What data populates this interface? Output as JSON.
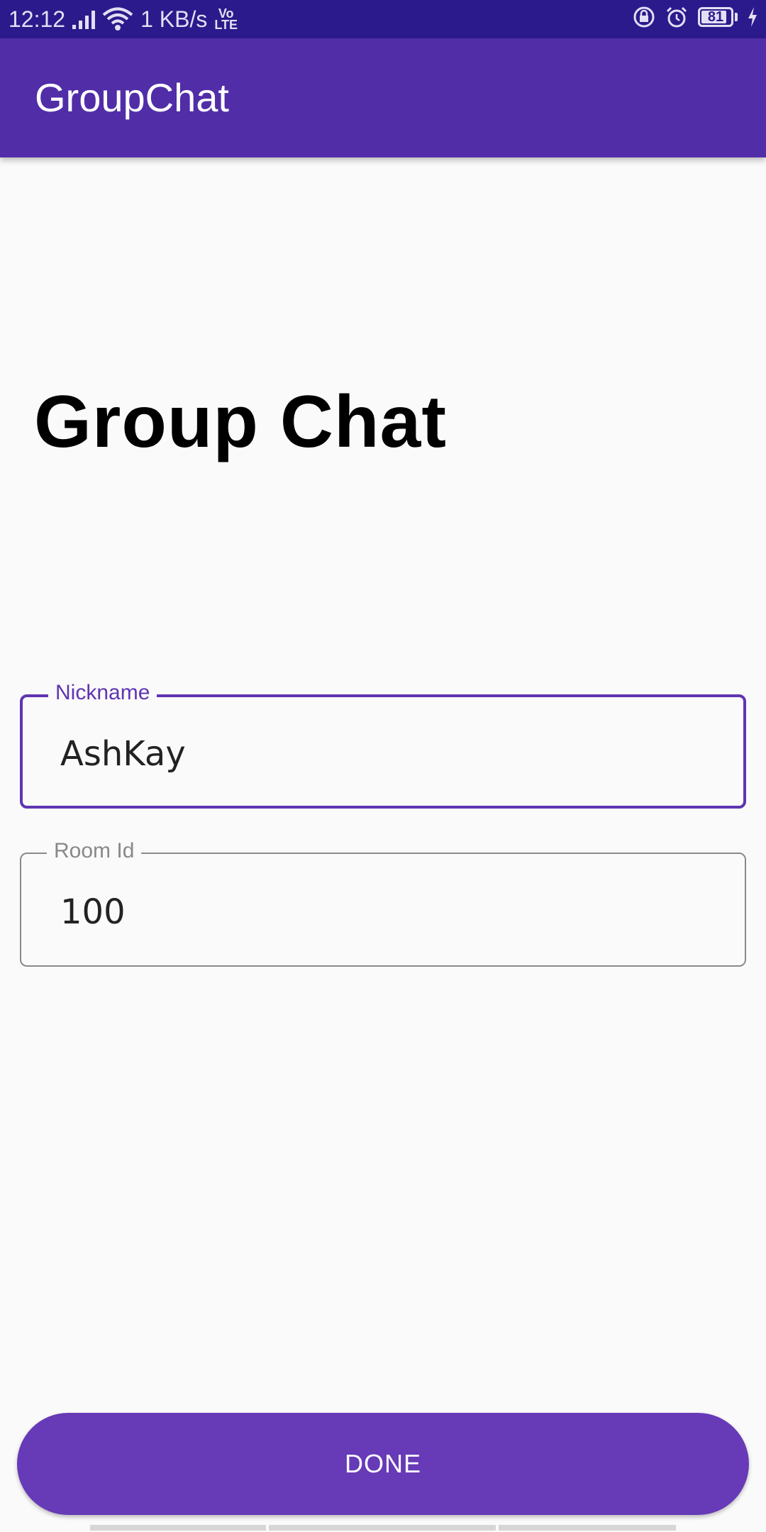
{
  "status_bar": {
    "time": "12:12",
    "net_speed": "1 KB/s",
    "volte_top": "Vo",
    "volte_bottom": "LTE",
    "battery": "81",
    "icons": [
      "signal-icon",
      "wifi-icon",
      "volte-icon",
      "screen-lock-icon",
      "alarm-icon",
      "battery-icon",
      "charging-icon"
    ]
  },
  "app_bar": {
    "title": "GroupChat"
  },
  "main": {
    "headline": "Group Chat",
    "nickname_field": {
      "label": "Nickname",
      "value": "AshKay"
    },
    "room_field": {
      "label": "Room Id",
      "value": "100"
    },
    "done_label": "DONE"
  },
  "colors": {
    "primary": "#512da8",
    "status_bar": "#2b1a8b",
    "accent": "#673ab7",
    "focus": "#5e35b1"
  }
}
